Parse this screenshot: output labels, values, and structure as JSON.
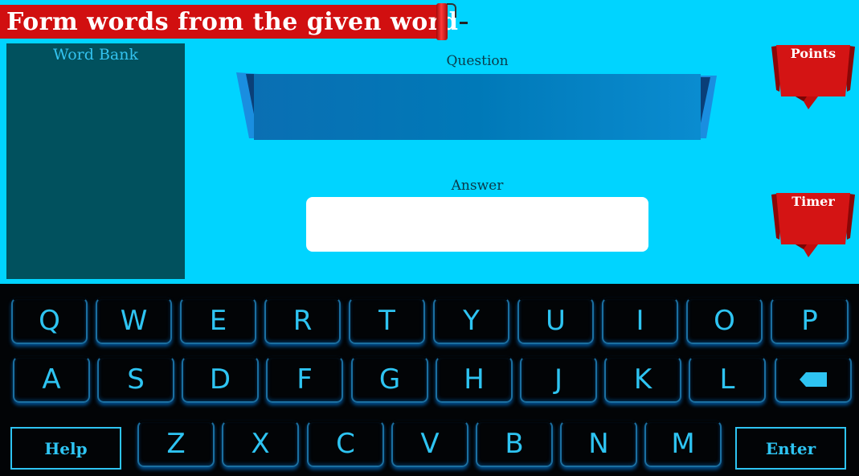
{
  "header": {
    "title": "Form words from the given word"
  },
  "word_bank": {
    "label": "Word Bank"
  },
  "question": {
    "label": "Question"
  },
  "answer": {
    "label": "Answer",
    "value": ""
  },
  "points": {
    "label": "Points"
  },
  "timer": {
    "label": "Timer"
  },
  "keyboard": {
    "row1": [
      "Q",
      "W",
      "E",
      "R",
      "T",
      "Y",
      "U",
      "I",
      "O",
      "P"
    ],
    "row2": [
      "A",
      "S",
      "D",
      "F",
      "G",
      "H",
      "J",
      "K",
      "L"
    ],
    "row3": [
      "Z",
      "X",
      "C",
      "V",
      "B",
      "N",
      "M"
    ],
    "help_label": "Help",
    "enter_label": "Enter",
    "backspace_icon": "backspace-icon"
  },
  "colors": {
    "background": "#00d4ff",
    "banner": "#d10f10",
    "word_bank": "#01515e",
    "key_glow": "#2ec4f2"
  }
}
